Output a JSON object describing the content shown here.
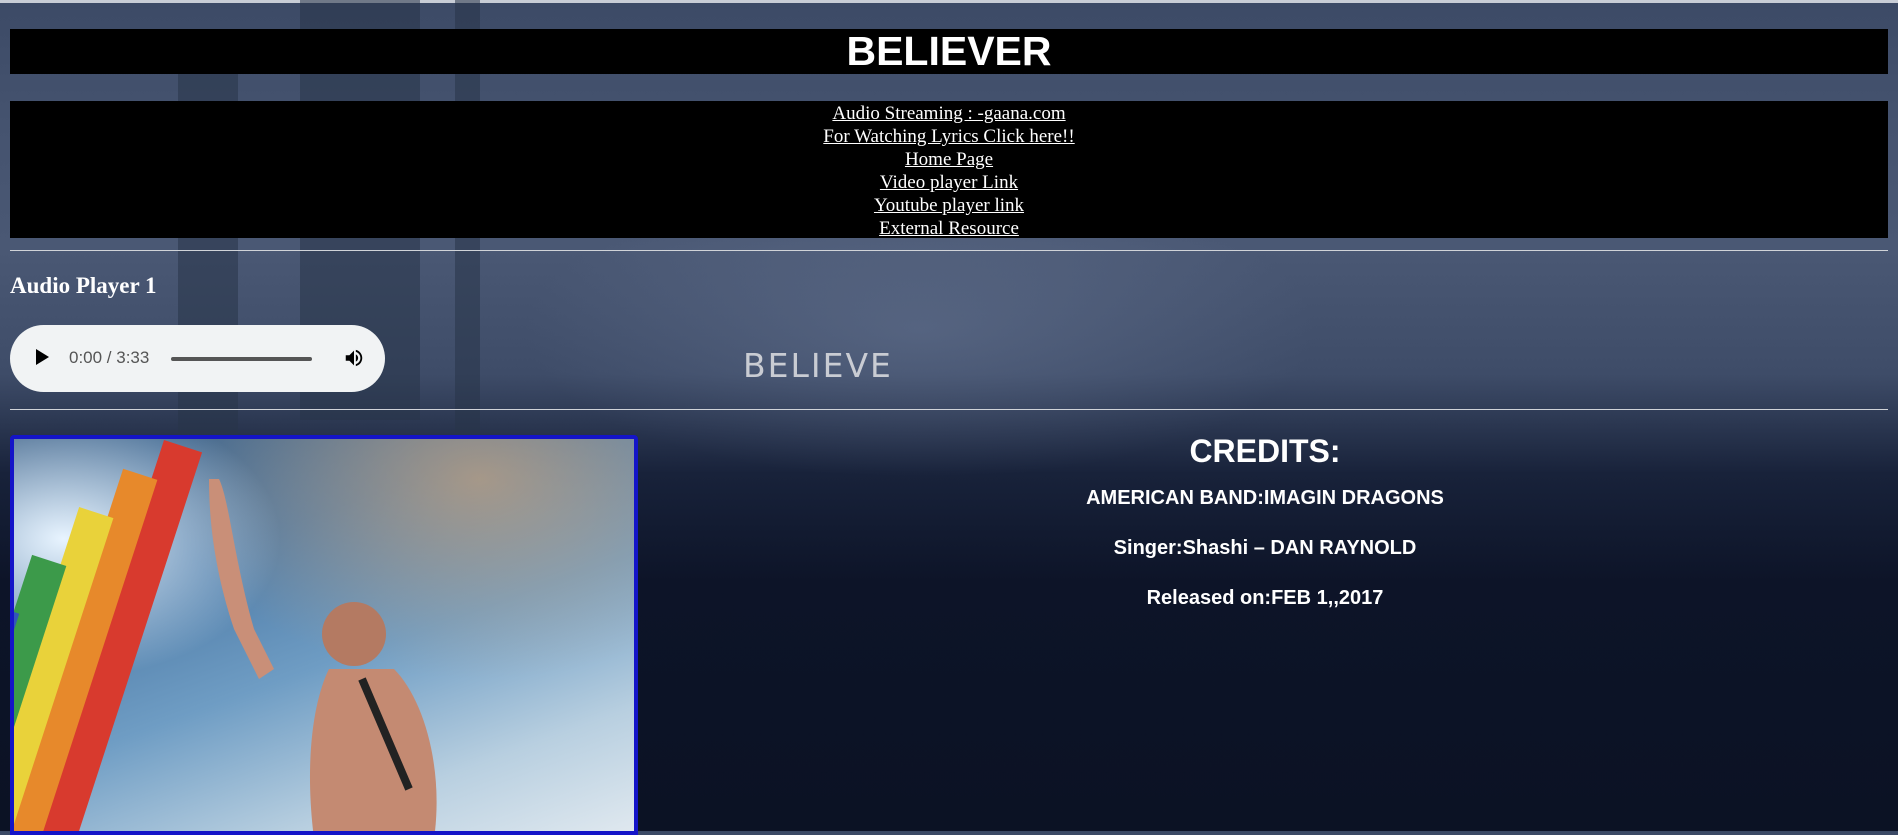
{
  "header": {
    "title": "BELIEVER"
  },
  "nav": {
    "links": [
      "Audio Streaming : -gaana.com",
      "For Watching Lyrics Click here!!",
      "Home Page",
      "Video player Link",
      "Youtube player link",
      "External Resource"
    ]
  },
  "player": {
    "heading": "Audio Player 1",
    "time_display": "0:00 / 3:33",
    "progress": 0
  },
  "background": {
    "watermark": "BELIEVE"
  },
  "credits": {
    "title": "CREDITS:",
    "band": "AMERICAN BAND:IMAGIN DRAGONS",
    "singer": "Singer:Shashi – DAN RAYNOLD",
    "released": "Released on:FEB 1,,2017"
  },
  "colors": {
    "page_bg": "#0b1224",
    "bar_bg": "#000000",
    "image_border": "#1414c8",
    "player_bg": "#f1f3f4"
  }
}
